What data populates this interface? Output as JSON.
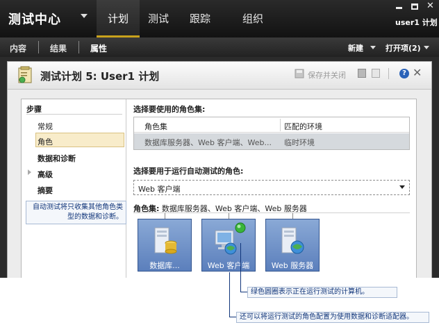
{
  "app": {
    "title": "测试中心",
    "user": "user1 计划",
    "nav": [
      "计划",
      "测试",
      "跟踪",
      "组织"
    ],
    "subnav": [
      "内容",
      "结果",
      "属性"
    ],
    "new_label": "新建",
    "open_label": "打开项(2)"
  },
  "header": {
    "plan_title": "测试计划 5: User1 计划",
    "save_close": "保存并关闭"
  },
  "steps": {
    "title": "步骤",
    "items": [
      "常规",
      "角色",
      "数据和诊断",
      "高级",
      "摘要"
    ],
    "note": "自动测试将只收集其他角色类型的数据和诊断。"
  },
  "roleset": {
    "title": "选择要使用的角色集:",
    "columns": [
      "角色集",
      "匹配的环境"
    ],
    "rows": [
      [
        "数据库服务器、Web 客户端、Web...",
        "临时环境"
      ]
    ]
  },
  "auto": {
    "title": "选择要用于运行自动测试的角色:",
    "selected": "Web 客户端"
  },
  "roleset_label": {
    "prefix": "角色集:",
    "value": " 数据库服务器、Web 客户端、Web 服务器"
  },
  "tiles": [
    {
      "label": "数据库...",
      "icon": "database-server-icon"
    },
    {
      "label": "Web 客户端",
      "icon": "web-client-icon"
    },
    {
      "label": "Web 服务器",
      "icon": "web-server-icon"
    }
  ],
  "callouts": {
    "green_circle": "绿色圆圈表示正在运行测试的计算机。",
    "config_roles": "还可以将运行测试的角色配置为使用数据和诊断适配器。"
  },
  "colors": {
    "accent": "#c9a21c",
    "tile": "#6f90c8",
    "callout_text": "#10357a",
    "active_indicator": "#39b53a"
  }
}
